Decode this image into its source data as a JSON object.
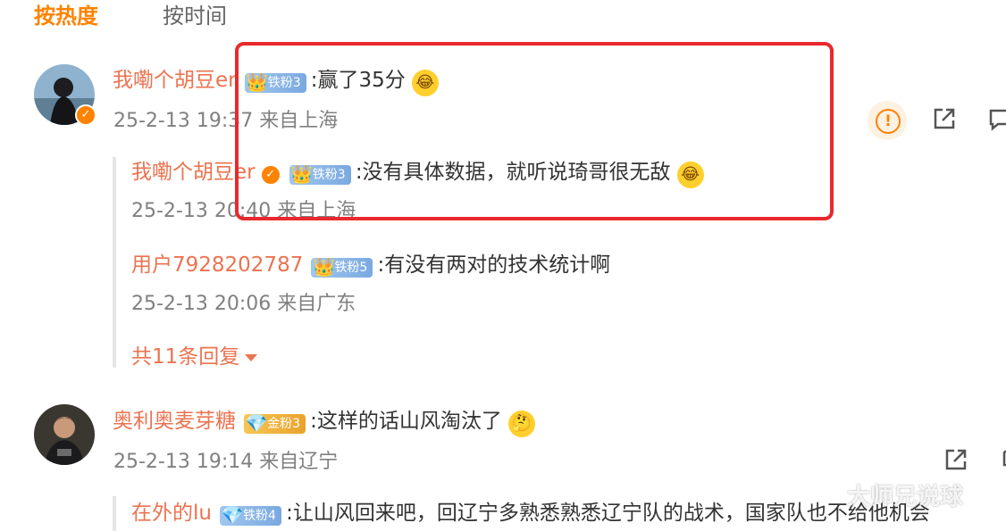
{
  "tabs": {
    "hot": "按热度",
    "time": "按时间"
  },
  "comments": [
    {
      "user": "我嘞个胡豆er",
      "fan_badge": "铁粉3",
      "text": ":赢了35分",
      "date": "25-2-13 19:37",
      "location": "来自上海",
      "replies": [
        {
          "user": "我嘞个胡豆er",
          "fan_badge": "铁粉3",
          "text": ":没有具体数据，就听说琦哥很无敌",
          "date": "25-2-13 20:40",
          "location": "来自上海"
        },
        {
          "user": "用户7928202787",
          "fan_badge": "铁粉5",
          "text": ":有没有两对的技术统计啊",
          "date": "25-2-13 20:06",
          "location": "来自广东"
        }
      ],
      "more_replies": {
        "prefix": "共",
        "count": "11",
        "suffix": "条回复"
      }
    },
    {
      "user": "奥利奥麦芽糖",
      "fan_badge": "金粉3",
      "text": ":这样的话山风淘汰了",
      "date": "25-2-13 19:14",
      "location": "来自辽宁",
      "replies": [
        {
          "user": "在外的lu",
          "fan_badge": "铁粉4",
          "text": ":让山风回来吧，回辽宁多熟悉熟悉辽宁队的战术，国家队也不给他机会"
        }
      ]
    }
  ],
  "watermark": "大师兄说球",
  "icons": {
    "verified": "verified-icon",
    "report": "report-icon",
    "share": "share-icon",
    "comment": "comment-icon",
    "emoji_laugh": "laugh-cry-emoji",
    "emoji_think": "thinking-emoji"
  },
  "colors": {
    "accent": "#ff8200",
    "username": "#eb7350",
    "highlight": "#e8292d"
  }
}
